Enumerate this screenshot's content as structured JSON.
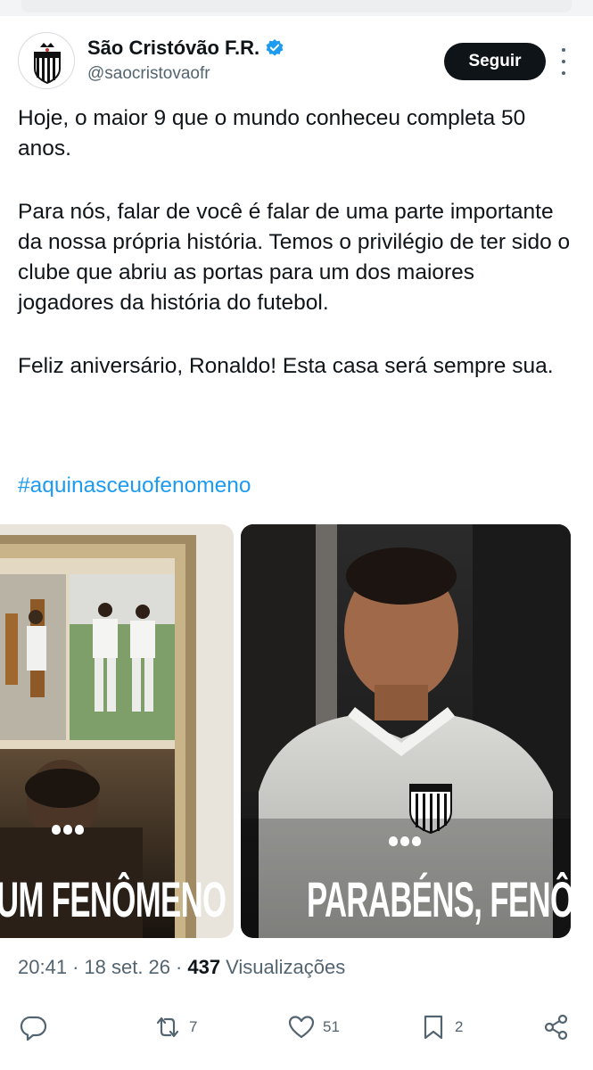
{
  "account": {
    "display_name": "São Cristóvão F.R.",
    "handle": "@saocristovaofr",
    "follow_label": "Seguir"
  },
  "post": {
    "paragraphs": [
      "Hoje, o maior 9 que o mundo conheceu completa 50 anos.",
      "Para nós, falar de você é falar de uma parte importante da nossa própria história. Temos o privilégio de ter sido o clube que abriu as portas para um dos maiores jogadores da história do futebol.",
      "Feliz aniversário, Ronaldo! Esta casa será sempre sua."
    ],
    "hashtag": "#aquinasceuofenomeno"
  },
  "media": {
    "left_caption": "UM FENÔMENO",
    "right_caption": "PARABÉNS, FENÔMENO!"
  },
  "meta": {
    "time": "20:41",
    "date": "18 set. 26",
    "views_count": "437",
    "views_label": "Visualizações",
    "separator": "·"
  },
  "actions": {
    "reposts": "7",
    "likes": "51",
    "bookmarks": "2"
  },
  "colors": {
    "accent": "#1d9bf0",
    "text": "#0f1419",
    "muted": "#536471",
    "button": "#0f1419"
  },
  "icons": [
    "verified-icon",
    "more-icon",
    "reply-icon",
    "repost-icon",
    "like-icon",
    "bookmark-icon",
    "share-icon"
  ]
}
